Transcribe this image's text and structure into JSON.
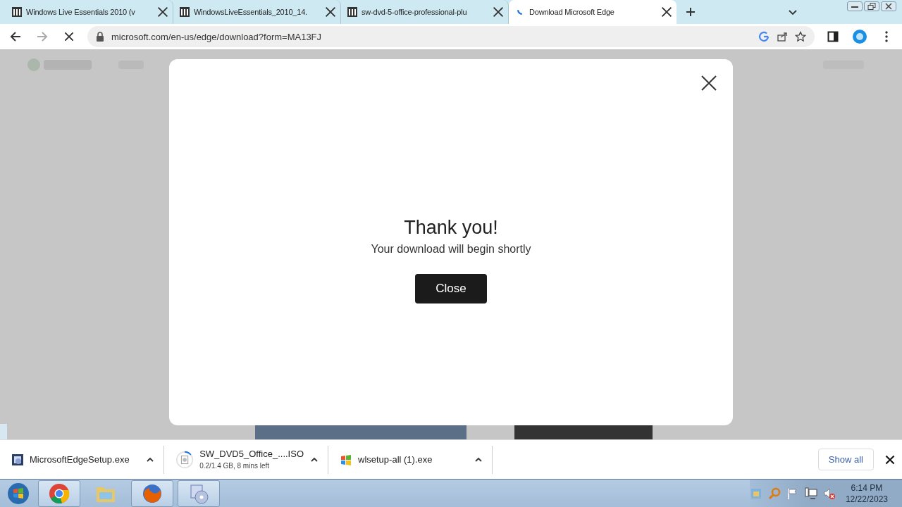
{
  "tabs": [
    {
      "title": "Windows Live Essentials 2010 (v",
      "selected": false,
      "loading": false
    },
    {
      "title": "WindowsLiveEssentials_2010_14.",
      "selected": false,
      "loading": false
    },
    {
      "title": "sw-dvd-5-office-professional-plu",
      "selected": false,
      "loading": false
    },
    {
      "title": "Download Microsoft Edge",
      "selected": true,
      "loading": true
    }
  ],
  "address_bar": {
    "url": "microsoft.com/en-us/edge/download?form=MA13FJ"
  },
  "dialog": {
    "heading": "Thank you!",
    "message": "Your download will begin shortly",
    "button": "Close"
  },
  "downloads": [
    {
      "kind": "complete",
      "name": "MicrosoftEdgeSetup.exe"
    },
    {
      "kind": "in_progress",
      "name": "SW_DVD5_Office_....ISO",
      "detail": "0.2/1.4 GB, 8 mins left",
      "level": 0.14
    },
    {
      "kind": "complete",
      "name": "wlsetup-all (1).exe"
    }
  ],
  "show_all": "Show all",
  "taskbar": {
    "time": "6:14 PM",
    "date": "12/22/2023"
  }
}
